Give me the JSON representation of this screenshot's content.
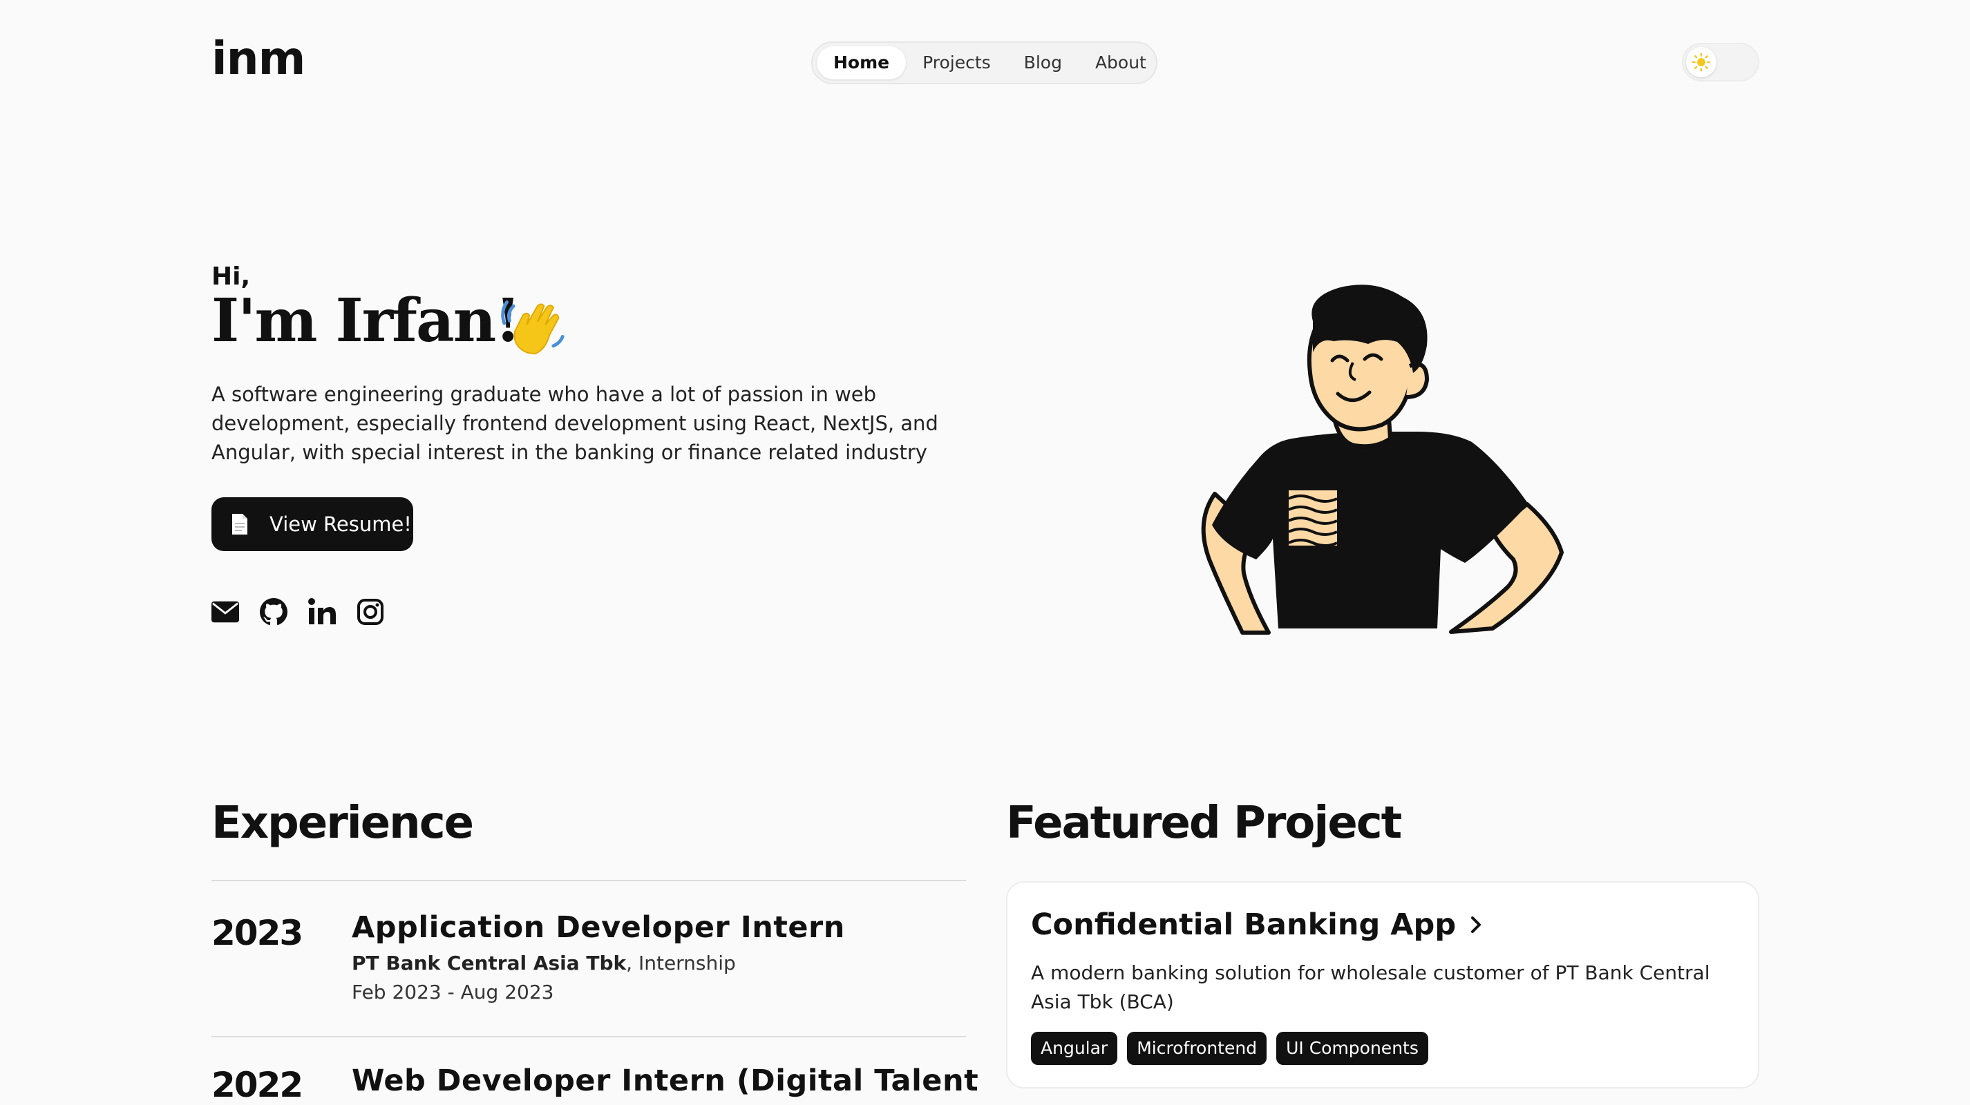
{
  "nav": {
    "logo": "inm",
    "items": [
      {
        "label": "Home",
        "active": true
      },
      {
        "label": "Projects"
      },
      {
        "label": "Blog"
      },
      {
        "label": "About"
      }
    ],
    "theme_icon": "sun-icon"
  },
  "hero": {
    "greeting": "Hi,",
    "name": "I'm Irfan!",
    "wave_icon": "waving-hand-icon",
    "intro": "A software engineering graduate who have a lot of passion in web development, especially frontend development using React, NextJS, and Angular, with special interest in the banking or finance related industry",
    "resume_button": "View Resume!",
    "social_icons": [
      "mail-icon",
      "github-icon",
      "linkedin-icon",
      "instagram-icon"
    ]
  },
  "experience": {
    "title": "Experience",
    "items": [
      {
        "year": "2023",
        "role": "Application Developer Intern",
        "company": "PT Bank Central Asia Tbk",
        "type": ", Internship",
        "dates": "Feb 2023 - Aug 2023"
      },
      {
        "year": "2022",
        "role": "Web Developer Intern (Digital Talent"
      }
    ]
  },
  "featured": {
    "title": "Featured Project",
    "project": {
      "title": "Confidential Banking App",
      "description": "A modern banking solution for wholesale customer of PT Bank Central Asia Tbk (BCA)",
      "tags": [
        "Angular",
        "Microfrontend",
        "UI Components"
      ]
    }
  },
  "colors": {
    "background": "#fafafa",
    "text": "#111111",
    "accent_yellow": "#f5c518",
    "skin": "#fcd9a5"
  }
}
